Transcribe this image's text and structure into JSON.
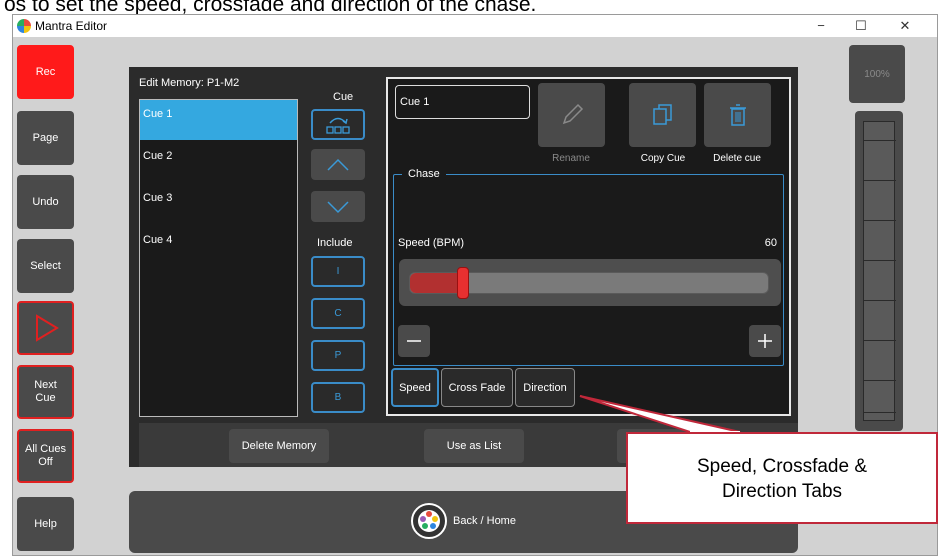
{
  "caption": "os to set the speed, crossfade and direction of the chase.",
  "window": {
    "title": "Mantra Editor",
    "controls": [
      "−",
      "☐",
      "✕"
    ]
  },
  "sidebar": {
    "rec": "Rec",
    "page": "Page",
    "undo": "Undo",
    "select": "Select",
    "next_cue": [
      "Next",
      "Cue"
    ],
    "all_cues_off": [
      "All Cues",
      "Off"
    ],
    "help": "Help"
  },
  "editor": {
    "header": "Edit Memory: P1-M2",
    "cues": [
      "Cue 1",
      "Cue 2",
      "Cue 3",
      "Cue 4"
    ],
    "cue_column_label": "Cue",
    "include_label": "Include",
    "include_buttons": [
      "I",
      "C",
      "P",
      "B"
    ]
  },
  "detail": {
    "cue_name": "Cue 1",
    "rename": "Rename",
    "copy_cue": "Copy Cue",
    "delete_cue": "Delete cue",
    "chase_title": "Chase",
    "speed_label": "Speed (BPM)",
    "speed_value": "60",
    "speed_fraction": 0.13,
    "tabs": [
      "Speed",
      "Cross Fade",
      "Direction"
    ]
  },
  "bottom": {
    "delete_memory": "Delete Memory",
    "use_as_list": "Use as List",
    "back_home": "Back / Home"
  },
  "right_column": {
    "percent": "100%"
  },
  "callout": {
    "line1": "Speed, Crossfade &",
    "line2": "Direction Tabs"
  },
  "colors": {
    "selected": "#34a8e0",
    "accent_blue": "#3a8cc8",
    "rec_red": "#ff1a1a",
    "callout_red": "#c0283a"
  }
}
